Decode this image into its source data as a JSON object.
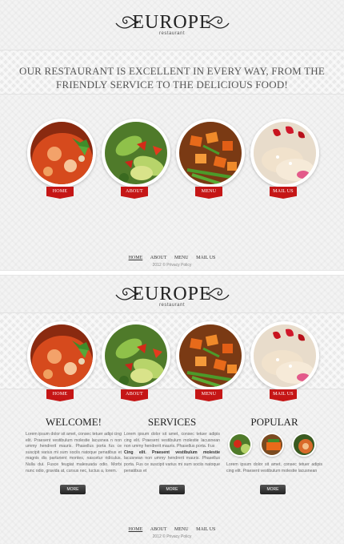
{
  "logo": {
    "title": "EUROPE",
    "subtitle": "restaurant"
  },
  "tagline": {
    "line1": "OUR RESTAURANT IS EXCELLENT IN EVERY WAY, FROM THE",
    "line2": "FRIENDLY SERVICE TO THE DELICIOUS FOOD!"
  },
  "nav": {
    "home": "HOME",
    "about": "ABOUT",
    "menu": "MENU",
    "mailus": "MAIL US"
  },
  "footer": {
    "home": "HOME",
    "about": "ABOUT",
    "menu": "MENU",
    "mailus": "MAIL US",
    "copyright": "2012 © Privacy Policy"
  },
  "sections": {
    "welcome": {
      "title": "WELCOME!",
      "text": "Lorem ipsum dolor sit amet, consec tetuer adipi cing elit. Praesent vestibulum molestie lacusnea n non ummy hendrerit mauris. Phasellus porta fus ce suscipit varius mi sum sociis natoque penatibus et magnis dis parturient montes, nascetur ridiculus. Nulla dui. Fusce feugiat malesuada odio. Morbi nunc odio, gravida at, cursus nec, luctus a, lorem.",
      "more": "MORE"
    },
    "services": {
      "title": "SERVICES",
      "text1": "Lorem ipsum dolor sit amet, consec tetuer adipis cing elit. Praesent vestibulum molestie lacusnean non ummy hendrerit mauris. Phasellus porta. Fus",
      "text2_bold": "Cing elit. Praesent vestibulum molestie",
      "text2": "lacusnean non ummy hendrerit mauris. Phasellus porta. Fus ce suscipit varius mi sum sociis natoque penatibus et",
      "more": "MORE"
    },
    "popular": {
      "title": "POPULAR",
      "text": "Lorem ipsum dolor sit amet, consec tetuer adipis cing elit. Praesent vestibulum molestie lacusnean",
      "more": "MORE"
    }
  },
  "colors": {
    "accent": "#c51616",
    "background": "#f3f3f3"
  },
  "icons": {
    "ribbon": "ribbon-label",
    "flourish": "scroll-ornament"
  }
}
